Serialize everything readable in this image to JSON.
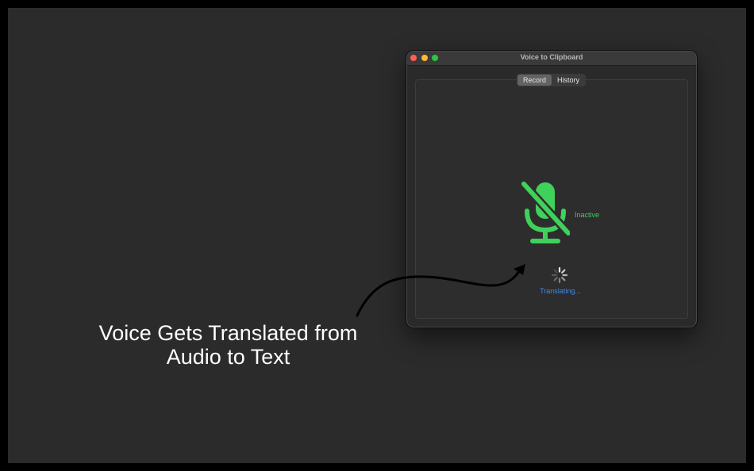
{
  "window": {
    "title": "Voice to Clipboard"
  },
  "tabs": [
    {
      "label": "Record",
      "active": true
    },
    {
      "label": "History",
      "active": false
    }
  ],
  "record": {
    "status": "Inactive",
    "progress_text": "Translating...",
    "mic_icon": "microphone-slash-icon",
    "spinner_icon": "loading-spinner-icon"
  },
  "annotation": {
    "line1": "Voice Gets Translated from",
    "line2": "Audio to Text"
  },
  "colors": {
    "accent_green": "#3fd15a",
    "accent_blue": "#3d8bf2",
    "traffic_close": "#fe5f57",
    "traffic_minimize": "#febc2e",
    "traffic_maximize": "#28c840"
  }
}
